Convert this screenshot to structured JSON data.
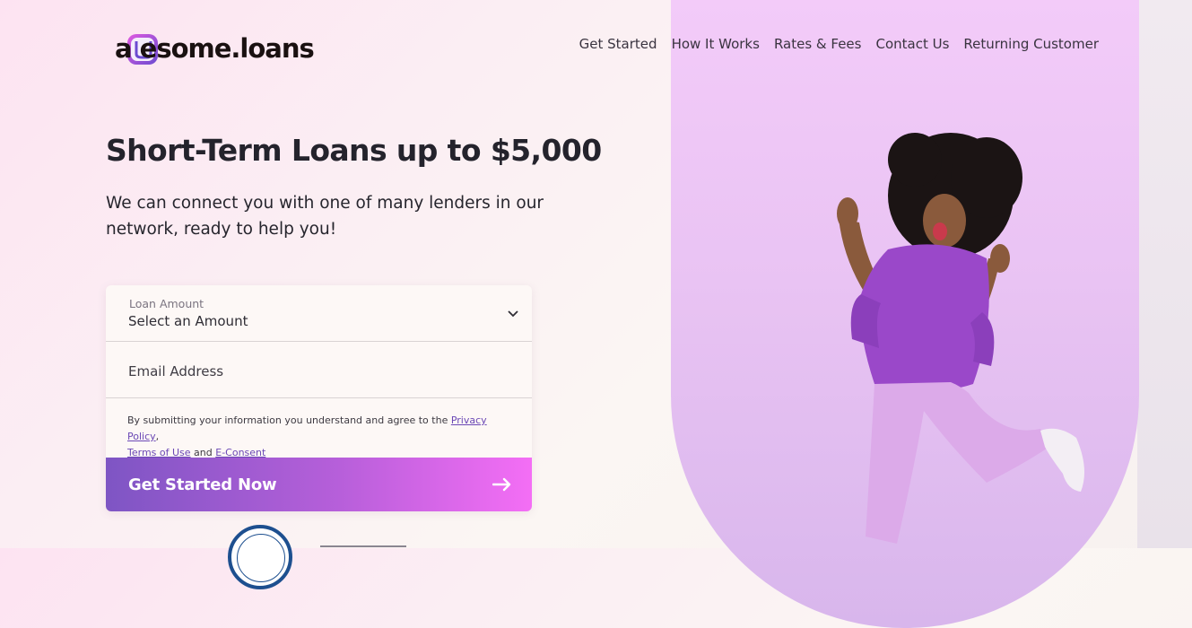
{
  "brand": {
    "name": "awesome.loans",
    "logo_text": "a  esome.loans"
  },
  "nav": {
    "items": [
      {
        "label": "Get Started"
      },
      {
        "label": "How It Works"
      },
      {
        "label": "Rates & Fees"
      },
      {
        "label": "Contact Us"
      },
      {
        "label": "Returning Customer"
      }
    ]
  },
  "hero": {
    "title": "Short-Term Loans up to $5,000",
    "subtitle": "We can connect you with one of many lenders in our network, ready to help you!"
  },
  "form": {
    "loan_amount": {
      "label": "Loan Amount",
      "value": "Select an Amount"
    },
    "email": {
      "placeholder": "Email Address"
    },
    "disclaimer": {
      "prefix": "By submitting your information you understand and agree to the ",
      "privacy_link": "Privacy Policy",
      "comma": ",",
      "terms_link": "Terms of Use",
      "and": " and ",
      "econsent_link": "E-Consent"
    },
    "submit_label": "Get Started Now"
  },
  "colors": {
    "accent_start": "#7e55c4",
    "accent_end": "#f46ef5",
    "link": "#6b48b5",
    "arch": "#e9c3f3"
  },
  "icons": [
    "logo-hand-icon",
    "chevron-down-icon",
    "arrow-right-icon"
  ]
}
